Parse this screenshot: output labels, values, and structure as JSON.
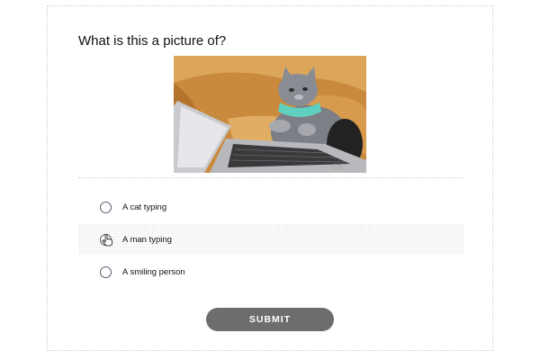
{
  "quiz": {
    "question": "What is this a picture of?",
    "options": [
      {
        "label": "A cat typing"
      },
      {
        "label": "A man typing"
      },
      {
        "label": "A smiling person"
      }
    ],
    "submit_label": "SUBMIT"
  },
  "colors": {
    "submit_bg": "#6d6d6d",
    "radio_border": "#5a5a6e"
  }
}
